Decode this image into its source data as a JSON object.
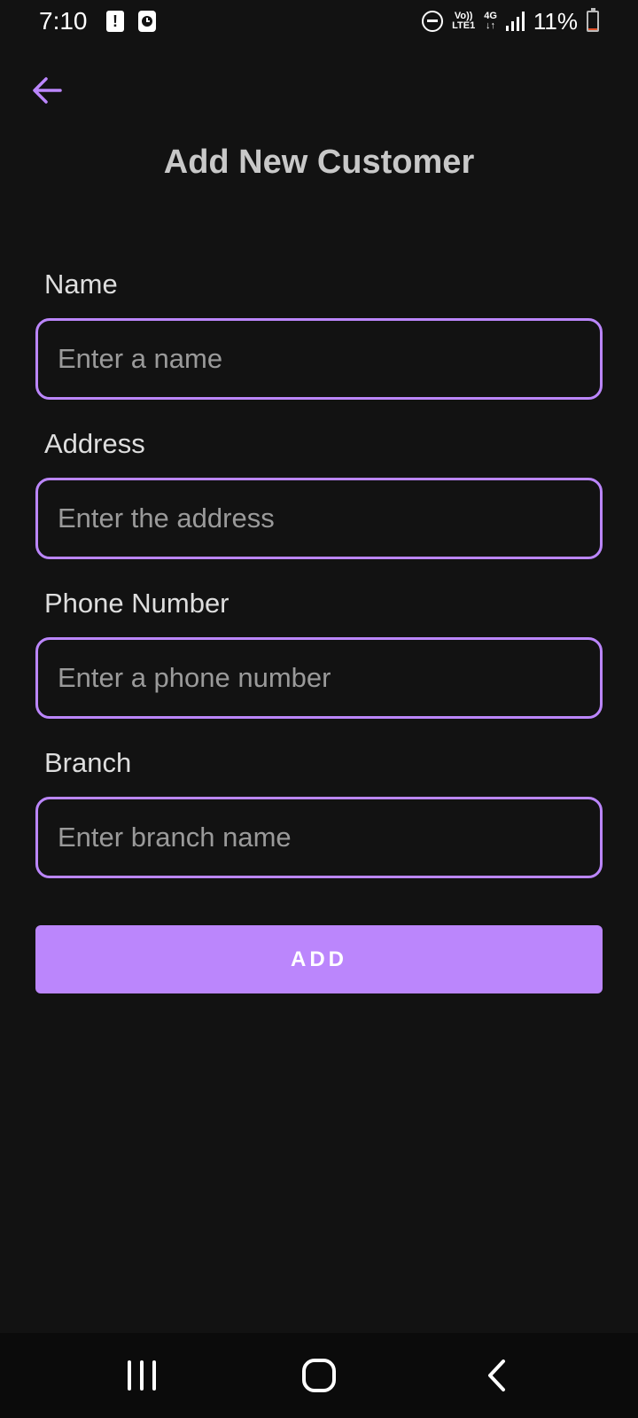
{
  "status_bar": {
    "time": "7:10",
    "network_top": "Vo))",
    "network_bottom": "LTE1",
    "network_type": "4G",
    "data_arrows": "↓↑",
    "battery_percent": "11%",
    "battery_level": 0.11,
    "icons": [
      "battery-alert-icon",
      "clock-notification-icon",
      "do-not-disturb-icon",
      "signal-icon",
      "battery-icon"
    ]
  },
  "header": {
    "back_icon": "arrow-left-icon",
    "title": "Add New Customer"
  },
  "form": {
    "fields": [
      {
        "label": "Name",
        "placeholder": "Enter a name",
        "value": ""
      },
      {
        "label": "Address",
        "placeholder": "Enter the address",
        "value": ""
      },
      {
        "label": "Phone Number",
        "placeholder": "Enter a phone number",
        "value": ""
      },
      {
        "label": "Branch",
        "placeholder": "Enter branch name",
        "value": ""
      }
    ],
    "submit_label": "ADD"
  },
  "nav_bar": {
    "icons": [
      "recent-apps-icon",
      "home-icon",
      "back-icon"
    ]
  },
  "colors": {
    "background": "#121212",
    "accent": "#bb86fc",
    "title_text": "#c8c8c8",
    "placeholder": "#9a9a9a"
  }
}
